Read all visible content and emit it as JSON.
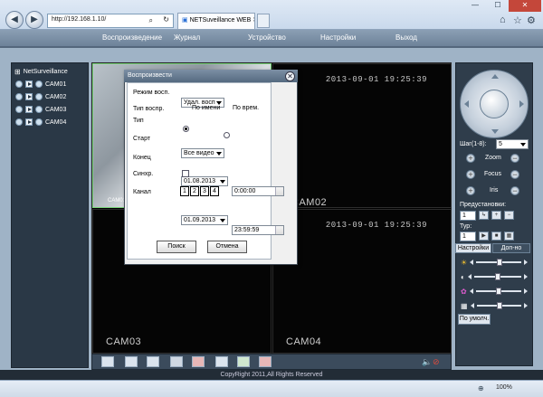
{
  "browser": {
    "address": "http://192.168.1.10/",
    "tab_title": "NETSuveillance WEB",
    "zoom": "100%"
  },
  "menu": {
    "playback": "Воспроизведение",
    "log": "Журнал",
    "device": "Устройство",
    "settings": "Настройки",
    "exit": "Выход"
  },
  "left_panel": {
    "root": "NetSurveillance",
    "cameras": [
      "CAM01",
      "CAM02",
      "CAM03",
      "CAM04"
    ]
  },
  "grid": {
    "timestamps": [
      "2013-09-01 19:25:39",
      "2013-09-01 19:25:39"
    ],
    "cam1_label": "CAM01",
    "cam2_label": "CAM02",
    "cam3_label": "CAM03",
    "cam4_label": "CAM04"
  },
  "ptz": {
    "step_label": "Шаг(1-8):",
    "step_value": "5",
    "zoom": "Zoom",
    "focus": "Focus",
    "iris": "Iris",
    "presets_label": "Предустановки:",
    "preset_value": "1",
    "tour_label": "Тур:",
    "tour_value": "1"
  },
  "settings_tabs": {
    "settings": "Настройки",
    "extra": "Доп-но",
    "defaults_button": "По умолч."
  },
  "footer": "CopyRight 2011,All Rights Reserved",
  "dialog": {
    "title": "Воспроизвести",
    "mode_label": "Режим восп.",
    "mode_value": "Удал. восп",
    "type_play_label": "Тип воспр.",
    "by_name": "По имени",
    "by_time": "По врем.",
    "type_label": "Тип",
    "type_value": "Все видео",
    "start_label": "Старт",
    "start_date": "01.08.2013",
    "start_time": "0:00:00",
    "end_label": "Конец",
    "end_date": "01.09.2013",
    "end_time": "23:59:59",
    "sync_label": "Синхр.",
    "channel_label": "Канал",
    "channels": [
      "1",
      "2",
      "3",
      "4"
    ],
    "search_button": "Поиск",
    "cancel_button": "Отмена"
  }
}
